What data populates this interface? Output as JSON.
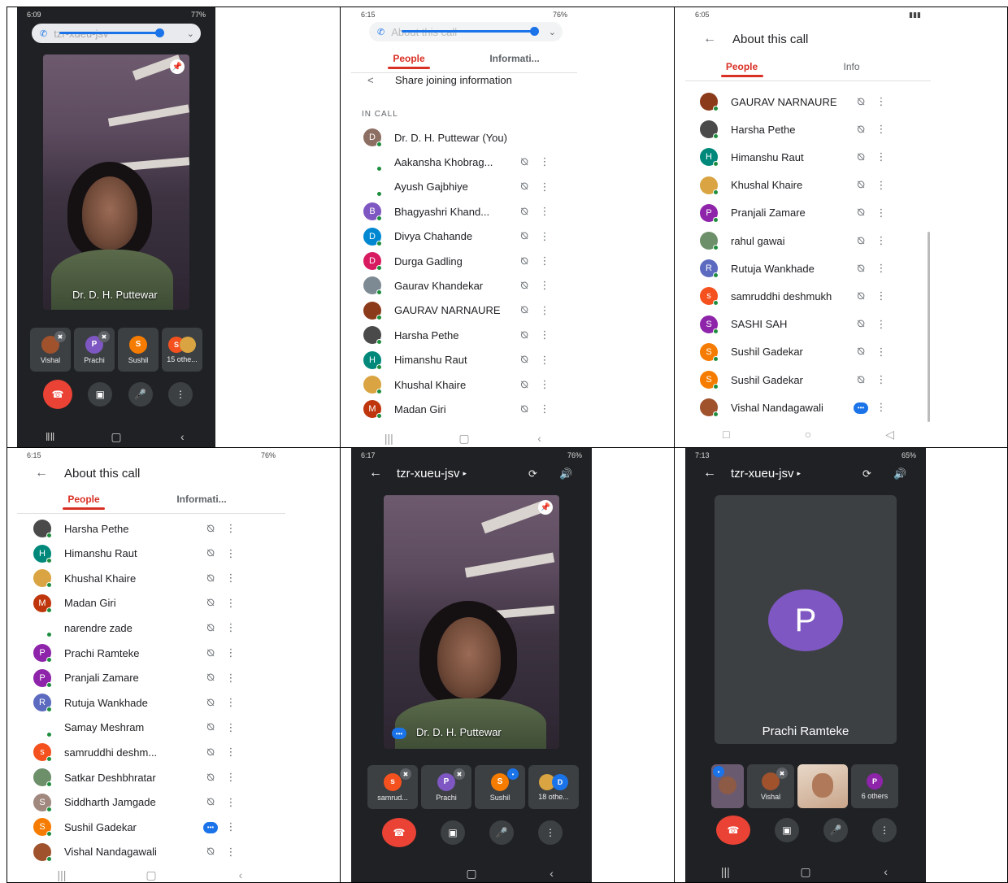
{
  "phone1": {
    "status_time": "6:09",
    "status_right": "77%",
    "pill_title": "tzr-xueu-jsv",
    "video_name": "Dr. D. H. Puttewar",
    "tiles": [
      {
        "label": "Vishal",
        "avatar": ""
      },
      {
        "label": "Prachi",
        "avatar": "P"
      },
      {
        "label": "Sushil",
        "avatar": "S"
      },
      {
        "label": "15 othe...",
        "avatar": "S"
      }
    ]
  },
  "phone2": {
    "status_time": "6:15",
    "status_right": "76%",
    "pill_title": "About this call",
    "tabs": [
      "People",
      "Informati..."
    ],
    "share_label": "Share joining information",
    "section": "IN CALL",
    "rows": [
      {
        "name": "Dr. D. H. Puttewar (You)",
        "avatar": "D",
        "color": "#8d6e63"
      },
      {
        "name": "Aakansha Khobrag...",
        "avatar": "",
        "color": "#ffffff"
      },
      {
        "name": "Ayush Gajbhiye",
        "avatar": "",
        "color": "#ffffff"
      },
      {
        "name": "Bhagyashri Khand...",
        "avatar": "B",
        "color": "#7e57c2"
      },
      {
        "name": "Divya Chahande",
        "avatar": "D",
        "color": "#0288d1"
      },
      {
        "name": "Durga Gadling",
        "avatar": "D",
        "color": "#d81b60"
      },
      {
        "name": "Gaurav Khandekar",
        "avatar": "",
        "color": "#7d8a94"
      },
      {
        "name": "GAURAV NARNAURE",
        "avatar": "",
        "color": "#8b3a1a"
      },
      {
        "name": "Harsha Pethe",
        "avatar": "",
        "color": "#4a4a4a"
      },
      {
        "name": "Himanshu Raut",
        "avatar": "H",
        "color": "#00897b"
      },
      {
        "name": "Khushal Khaire",
        "avatar": "",
        "color": "#d9a441"
      },
      {
        "name": "Madan Giri",
        "avatar": "M",
        "color": "#bf360c"
      }
    ]
  },
  "phone3": {
    "status_time": "6:05",
    "title": "About this call",
    "tabs": [
      "People",
      "Info"
    ],
    "rows": [
      {
        "name": "GAURAV NARNAURE",
        "avatar": "",
        "color": "#8b3a1a",
        "speaking": false
      },
      {
        "name": "Harsha Pethe",
        "avatar": "",
        "color": "#4a4a4a",
        "speaking": false
      },
      {
        "name": "Himanshu Raut",
        "avatar": "H",
        "color": "#00897b",
        "speaking": false
      },
      {
        "name": "Khushal Khaire",
        "avatar": "",
        "color": "#d9a441",
        "speaking": false
      },
      {
        "name": "Pranjali Zamare",
        "avatar": "P",
        "color": "#8e24aa",
        "speaking": false
      },
      {
        "name": "rahul gawai",
        "avatar": "",
        "color": "#6d8f6a",
        "speaking": false
      },
      {
        "name": "Rutuja Wankhade",
        "avatar": "R",
        "color": "#5c6bc0",
        "speaking": false
      },
      {
        "name": "samruddhi deshmukh",
        "avatar": "s",
        "color": "#f4511e",
        "speaking": false
      },
      {
        "name": "SASHI SAH",
        "avatar": "S",
        "color": "#8e24aa",
        "speaking": false
      },
      {
        "name": "Sushil Gadekar",
        "avatar": "S",
        "color": "#f57c00",
        "speaking": false
      },
      {
        "name": "Sushil Gadekar",
        "avatar": "S",
        "color": "#f57c00",
        "speaking": false
      },
      {
        "name": "Vishal Nandagawali",
        "avatar": "",
        "color": "#a0522d",
        "speaking": true
      }
    ]
  },
  "phone4": {
    "status_time": "6:15",
    "status_right": "76%",
    "title": "About this call",
    "tabs": [
      "People",
      "Informati..."
    ],
    "rows": [
      {
        "name": "Harsha Pethe",
        "avatar": "",
        "color": "#4a4a4a",
        "speaking": false
      },
      {
        "name": "Himanshu Raut",
        "avatar": "H",
        "color": "#00897b",
        "speaking": false
      },
      {
        "name": "Khushal Khaire",
        "avatar": "",
        "color": "#d9a441",
        "speaking": false
      },
      {
        "name": "Madan Giri",
        "avatar": "M",
        "color": "#bf360c",
        "speaking": false
      },
      {
        "name": "narendre zade",
        "avatar": "",
        "color": "#ffffff",
        "speaking": false
      },
      {
        "name": "Prachi Ramteke",
        "avatar": "P",
        "color": "#8e24aa",
        "speaking": false
      },
      {
        "name": "Pranjali Zamare",
        "avatar": "P",
        "color": "#8e24aa",
        "speaking": false
      },
      {
        "name": "Rutuja Wankhade",
        "avatar": "R",
        "color": "#5c6bc0",
        "speaking": false
      },
      {
        "name": "Samay Meshram",
        "avatar": "",
        "color": "#ffffff",
        "speaking": false
      },
      {
        "name": "samruddhi deshm...",
        "avatar": "s",
        "color": "#f4511e",
        "speaking": false
      },
      {
        "name": "Satkar Deshbhratar",
        "avatar": "",
        "color": "#6d8f6a",
        "speaking": false
      },
      {
        "name": "Siddharth Jamgade",
        "avatar": "S",
        "color": "#a1887f",
        "speaking": false
      },
      {
        "name": "Sushil Gadekar",
        "avatar": "S",
        "color": "#f57c00",
        "speaking": true
      },
      {
        "name": "Vishal Nandagawali",
        "avatar": "",
        "color": "#a0522d",
        "speaking": false
      }
    ]
  },
  "phone5": {
    "status_time": "6:17",
    "status_right": "76%",
    "title": "tzr-xueu-jsv",
    "video_name": "Dr. D. H. Puttewar",
    "tiles": [
      {
        "label": "samrud...",
        "avatar": "s"
      },
      {
        "label": "Prachi",
        "avatar": "P"
      },
      {
        "label": "Sushil",
        "avatar": "S"
      },
      {
        "label": "18 othe...",
        "avatar": "D"
      }
    ]
  },
  "phone6": {
    "status_time": "7:13",
    "status_right": "65%",
    "title": "tzr-xueu-jsv",
    "big_avatar": "P",
    "big_name": "Prachi Ramteke",
    "tiles": [
      {
        "label": "",
        "avatar": ""
      },
      {
        "label": "Vishal",
        "avatar": ""
      },
      {
        "label": "",
        "avatar": ""
      },
      {
        "label": "6 others",
        "avatar": "P"
      }
    ]
  }
}
